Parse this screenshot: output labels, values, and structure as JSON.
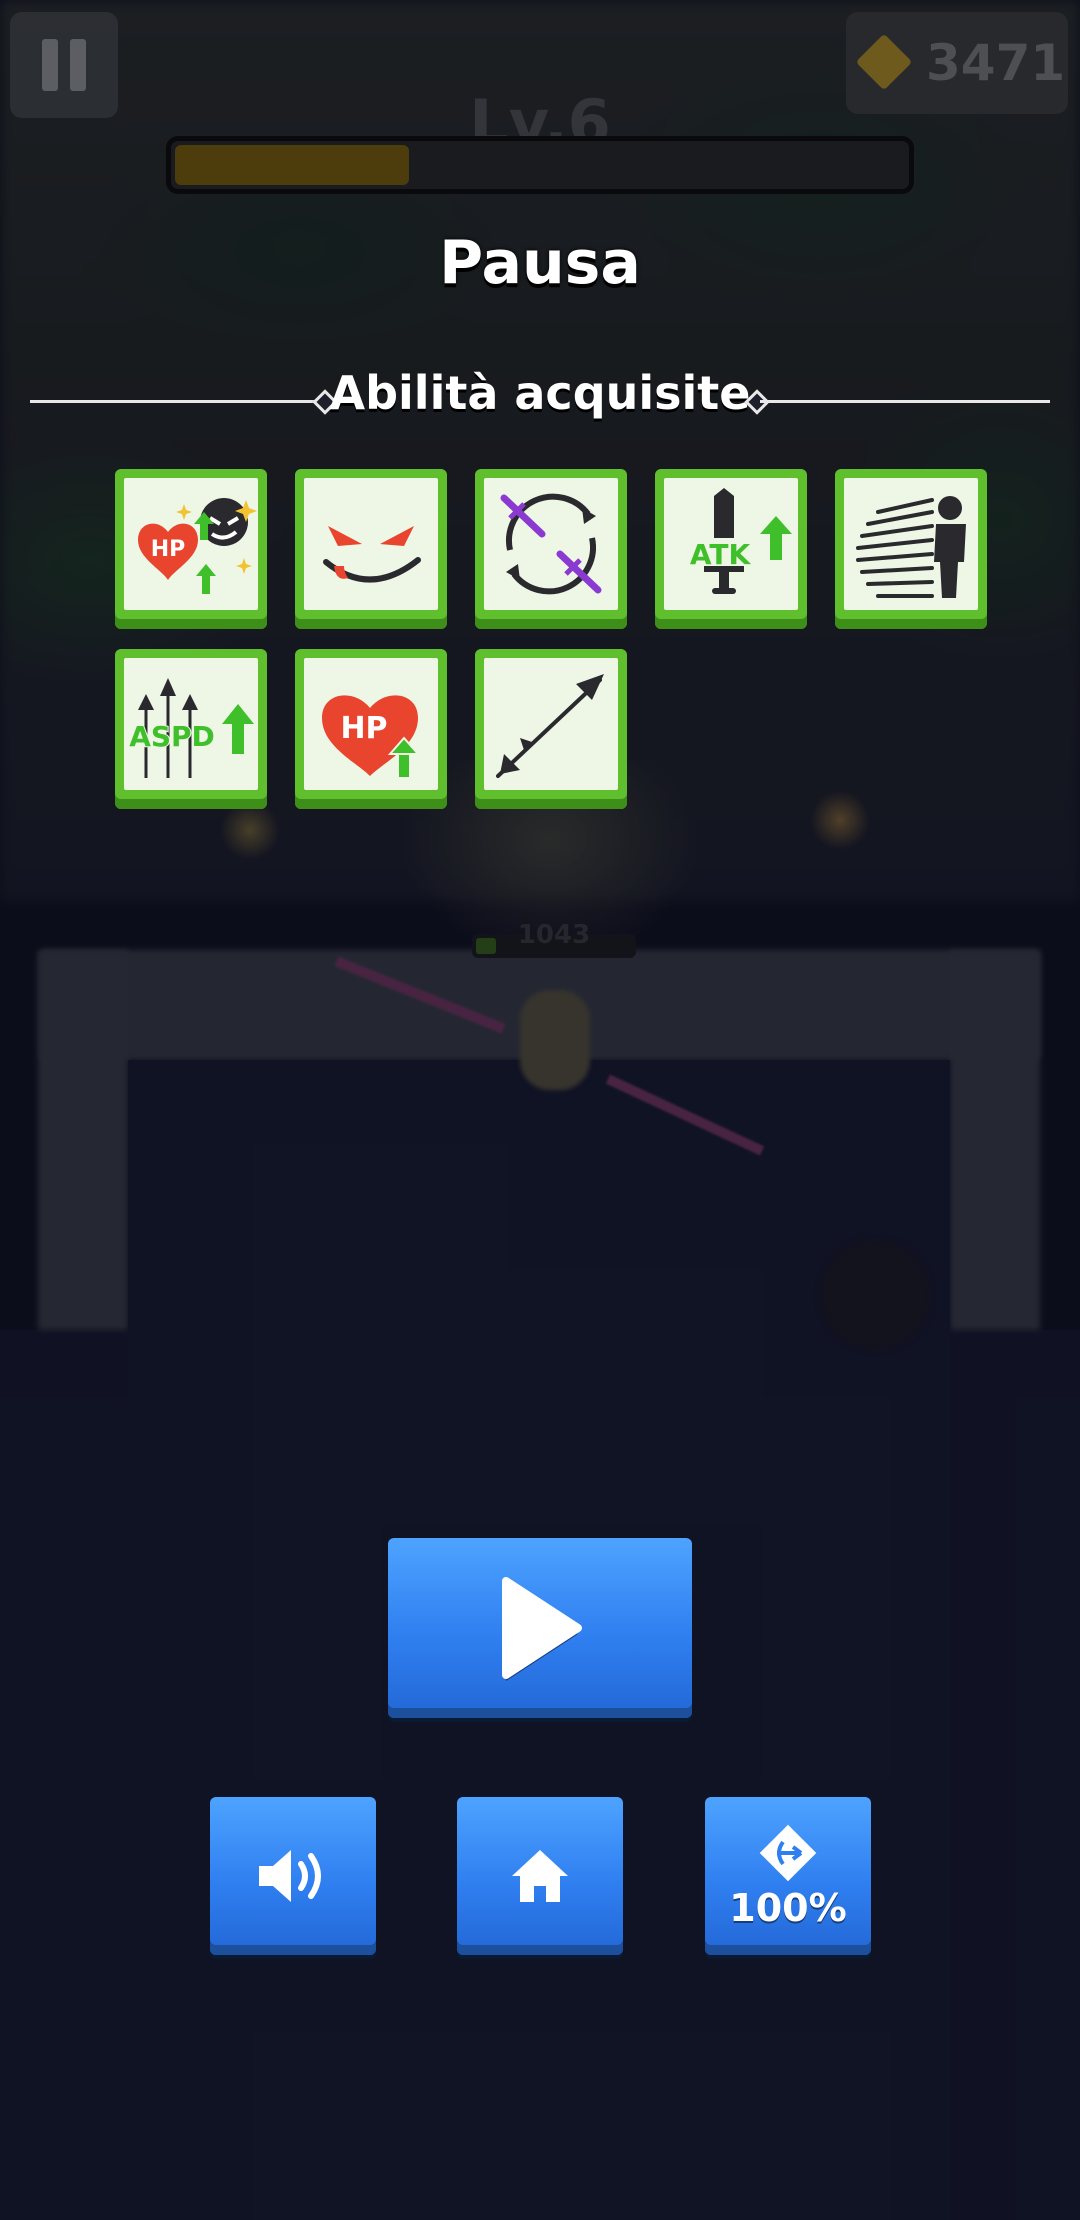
{
  "hud": {
    "pause_icon": "pause-icon",
    "gem_icon": "gem-icon",
    "gems": "3471",
    "level_label": "Lv.6",
    "xp_progress": 0.32
  },
  "pause_menu": {
    "title": "Pausa",
    "section_title": "Abilità acquisite",
    "skills": [
      {
        "icon": "hp-boost-icon",
        "text": "HP"
      },
      {
        "icon": "rage-face-icon",
        "text": ""
      },
      {
        "icon": "sword-orbit-icon",
        "text": ""
      },
      {
        "icon": "attack-boost-icon",
        "text": "ATK"
      },
      {
        "icon": "speed-dash-icon",
        "text": ""
      },
      {
        "icon": "attack-speed-boost-icon",
        "text": "ASPD"
      },
      {
        "icon": "max-hp-boost-icon",
        "text": "HP"
      },
      {
        "icon": "arrow-icon",
        "text": ""
      }
    ]
  },
  "enemy": {
    "hp_value": "1043"
  },
  "buttons": {
    "play_icon": "play-icon",
    "sound_icon": "speaker-icon",
    "home_icon": "home-icon",
    "speed_icon": "bow-icon",
    "speed_label": "100%"
  },
  "colors": {
    "skill_green": "#5fbf2c",
    "button_blue": "#2f7ff0",
    "upgrade_arrow": "#3fbf2a"
  }
}
